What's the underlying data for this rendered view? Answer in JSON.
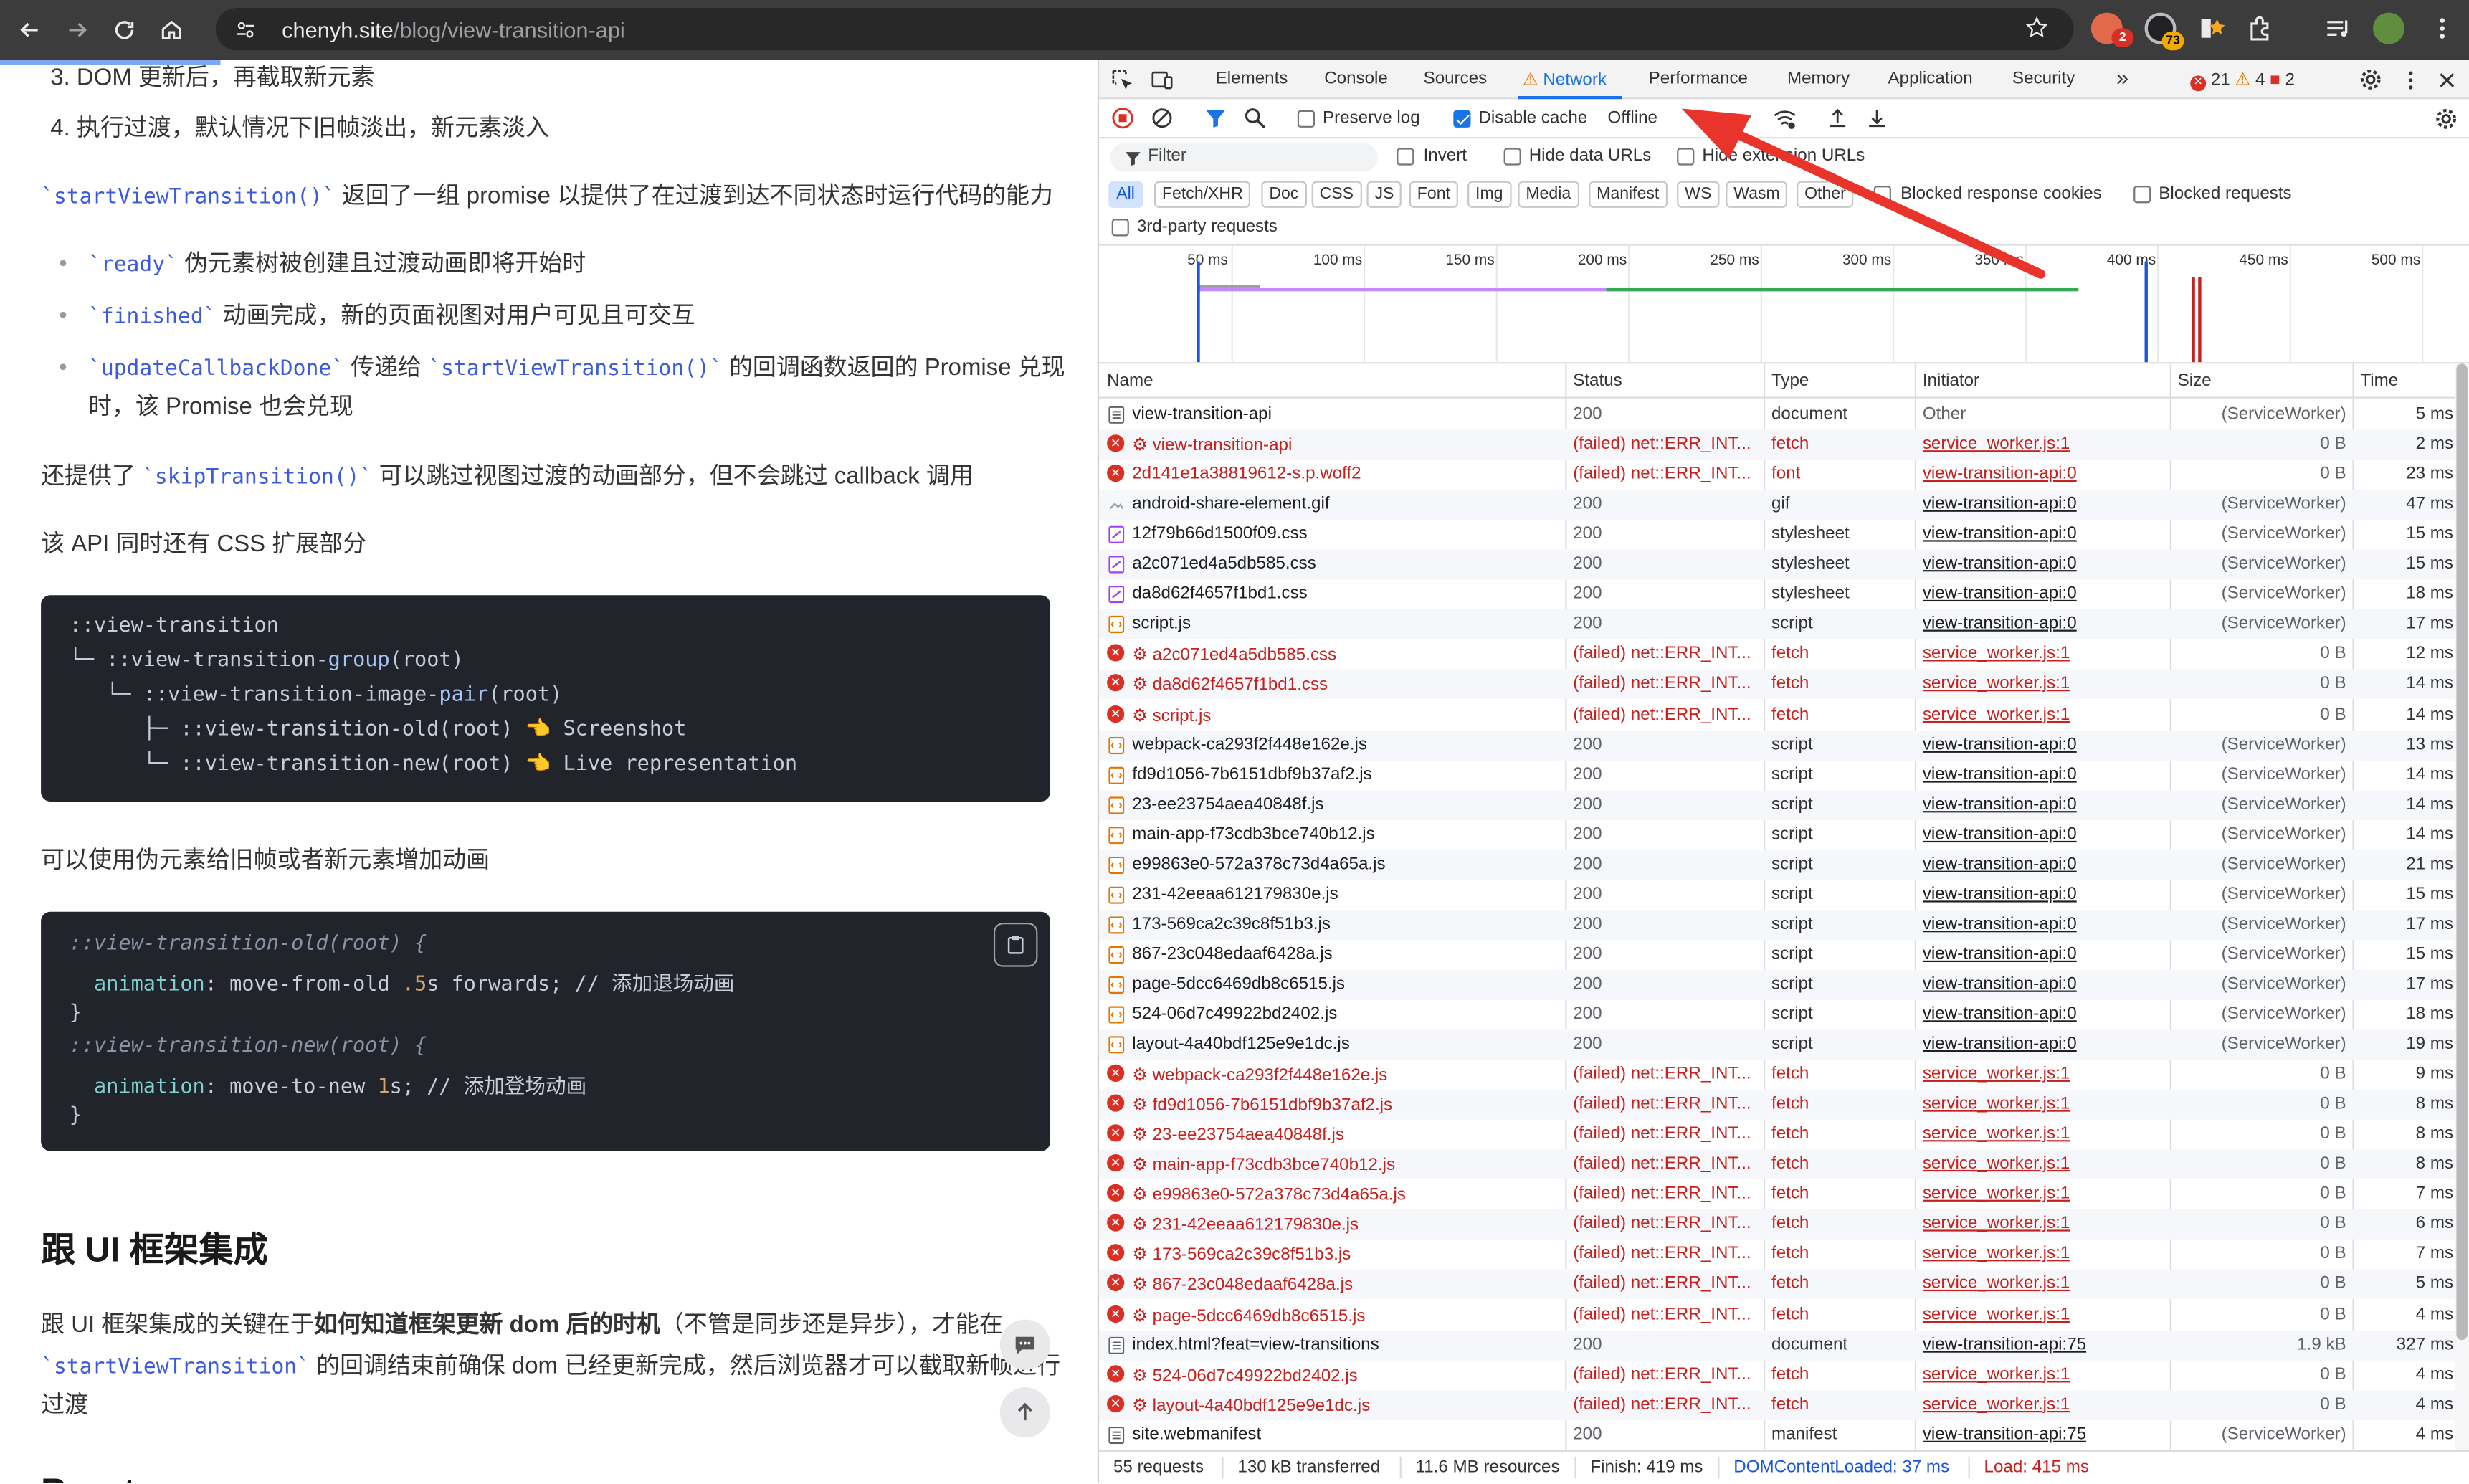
{
  "browser": {
    "url_host": "chenyh.site",
    "url_path": "/blog/view-transition-api",
    "ext_badges": [
      "2",
      "73"
    ]
  },
  "article": {
    "ol": [
      "3.  DOM 更新后，再截取新元素",
      "4.  执行过渡，默认情况下旧帧淡出，新元素淡入"
    ],
    "p1_code": "`startViewTransition()`",
    "p1_text": " 返回了一组 promise 以提供了在过渡到达不同状态时运行代码的能力",
    "li1_code": "`ready`",
    "li1_text": " 伪元素树被创建且过渡动画即将开始时",
    "li2_code": "`finished`",
    "li2_text": " 动画完成，新的页面视图对用户可见且可交互",
    "li3_code": "`updateCallbackDone`",
    "li3_mid": " 传递给 ",
    "li3_code2": "`startViewTransition()`",
    "li3_text": " 的回调函数返回的 Promise 兑现",
    "li3_text2": "时，该 Promise 也会兑现",
    "p2_text": "还提供了 ",
    "p2_code": "`skipTransition()`",
    "p2_text2": " 可以跳过视图过渡的动画部分，但不会跳过 callback 调用",
    "p3": "该 API 同时还有 CSS 扩展部分",
    "tree": {
      "l1_pre": "::view-transition",
      "l2_pre": "└─ ::view-transition-",
      "l2_fn": "group",
      "l2_arg": "(root)",
      "l3_pre": "   └─ ::view-transition-image-",
      "l3_fn": "pair",
      "l3_arg": "(root)",
      "l4_pre": "      ├─ ::view-transition-old",
      "l4_arg": "(root) ",
      "l4_emoji": "👈",
      "l4_text": " Screenshot",
      "l5_pre": "      └─ ::view-transition-new",
      "l5_arg": "(root) ",
      "l5_emoji": "👈",
      "l5_text": " Live representation"
    },
    "p4": "可以使用伪元素给旧帧或者新元素增加动画",
    "css": {
      "l1": "::view-transition-old(root) {",
      "l2_prop": "animation",
      "l2_val1": ": move-from-old ",
      "l2_num": ".5",
      "l2_val2": "s forwards; // 添加退场动画",
      "l3": "}",
      "l4": "::view-transition-new(root) {",
      "l5_prop": "animation",
      "l5_val1": ": move-to-new ",
      "l5_num": "1",
      "l5_val2": "s; // 添加登场动画",
      "l6": "}"
    },
    "h2": "跟 UI 框架集成",
    "p5_a": "跟 UI 框架集成的关键在于",
    "p5_b": "如何知道框架更新 dom 后的时机",
    "p5_c": "（不管是同步还是异步），才能在",
    "p6_code": "`startViewTransition`",
    "p6_text": " 的回调结束前确保 dom 已经更新完成，然后浏览器才可以截取新帧进行",
    "p7": "过渡",
    "h2b": "React"
  },
  "devtools": {
    "tabs": [
      "Elements",
      "Console",
      "Sources",
      "Network",
      "Performance",
      "Memory",
      "Application",
      "Security"
    ],
    "active_tab": "Network",
    "more_tabs": "»",
    "counts": {
      "errors": "21",
      "warnings": "4",
      "issues": "2"
    },
    "preserve_log": "Preserve log",
    "disable_cache": "Disable cache",
    "throttle": "Offline",
    "filter_placeholder": "Filter",
    "invert": "Invert",
    "hide_data_urls": "Hide data URLs",
    "hide_ext_urls": "Hide extension URLs",
    "type_filters": [
      "All",
      "Fetch/XHR",
      "Doc",
      "CSS",
      "JS",
      "Font",
      "Img",
      "Media",
      "Manifest",
      "WS",
      "Wasm",
      "Other"
    ],
    "blocked_cookies": "Blocked response cookies",
    "blocked_requests": "Blocked requests",
    "third_party": "3rd-party requests",
    "ticks": [
      "50 ms",
      "100 ms",
      "150 ms",
      "200 ms",
      "250 ms",
      "300 ms",
      "350 ms",
      "400 ms",
      "450 ms",
      "500 ms"
    ],
    "columns": [
      "Name",
      "Status",
      "Type",
      "Initiator",
      "Size",
      "Time"
    ],
    "rows": [
      {
        "name": "view-transition-api",
        "status": "200",
        "type": "document",
        "init": "Other",
        "size": "(ServiceWorker)",
        "time": "5 ms",
        "failed": false,
        "kind": "doc"
      },
      {
        "name": "⚙ view-transition-api",
        "status": "(failed) net::ERR_INT...",
        "type": "fetch",
        "init": "service_worker.js:1",
        "size": "0 B",
        "time": "2 ms",
        "failed": true,
        "kind": "err"
      },
      {
        "name": "2d141e1a38819612-s.p.woff2",
        "status": "(failed) net::ERR_INT...",
        "type": "font",
        "init": "view-transition-api:0",
        "size": "0 B",
        "time": "23 ms",
        "failed": true,
        "kind": "err"
      },
      {
        "name": "android-share-element.gif",
        "status": "200",
        "type": "gif",
        "init": "view-transition-api:0",
        "size": "(ServiceWorker)",
        "time": "47 ms",
        "failed": false,
        "kind": "img"
      },
      {
        "name": "12f79b66d1500f09.css",
        "status": "200",
        "type": "stylesheet",
        "init": "view-transition-api:0",
        "size": "(ServiceWorker)",
        "time": "15 ms",
        "failed": false,
        "kind": "css"
      },
      {
        "name": "a2c071ed4a5db585.css",
        "status": "200",
        "type": "stylesheet",
        "init": "view-transition-api:0",
        "size": "(ServiceWorker)",
        "time": "15 ms",
        "failed": false,
        "kind": "css"
      },
      {
        "name": "da8d62f4657f1bd1.css",
        "status": "200",
        "type": "stylesheet",
        "init": "view-transition-api:0",
        "size": "(ServiceWorker)",
        "time": "18 ms",
        "failed": false,
        "kind": "css"
      },
      {
        "name": "script.js",
        "status": "200",
        "type": "script",
        "init": "view-transition-api:0",
        "size": "(ServiceWorker)",
        "time": "17 ms",
        "failed": false,
        "kind": "js"
      },
      {
        "name": "⚙ a2c071ed4a5db585.css",
        "status": "(failed) net::ERR_INT...",
        "type": "fetch",
        "init": "service_worker.js:1",
        "size": "0 B",
        "time": "12 ms",
        "failed": true,
        "kind": "err"
      },
      {
        "name": "⚙ da8d62f4657f1bd1.css",
        "status": "(failed) net::ERR_INT...",
        "type": "fetch",
        "init": "service_worker.js:1",
        "size": "0 B",
        "time": "14 ms",
        "failed": true,
        "kind": "err"
      },
      {
        "name": "⚙ script.js",
        "status": "(failed) net::ERR_INT...",
        "type": "fetch",
        "init": "service_worker.js:1",
        "size": "0 B",
        "time": "14 ms",
        "failed": true,
        "kind": "err"
      },
      {
        "name": "webpack-ca293f2f448e162e.js",
        "status": "200",
        "type": "script",
        "init": "view-transition-api:0",
        "size": "(ServiceWorker)",
        "time": "13 ms",
        "failed": false,
        "kind": "js"
      },
      {
        "name": "fd9d1056-7b6151dbf9b37af2.js",
        "status": "200",
        "type": "script",
        "init": "view-transition-api:0",
        "size": "(ServiceWorker)",
        "time": "14 ms",
        "failed": false,
        "kind": "js"
      },
      {
        "name": "23-ee23754aea40848f.js",
        "status": "200",
        "type": "script",
        "init": "view-transition-api:0",
        "size": "(ServiceWorker)",
        "time": "14 ms",
        "failed": false,
        "kind": "js"
      },
      {
        "name": "main-app-f73cdb3bce740b12.js",
        "status": "200",
        "type": "script",
        "init": "view-transition-api:0",
        "size": "(ServiceWorker)",
        "time": "14 ms",
        "failed": false,
        "kind": "js"
      },
      {
        "name": "e99863e0-572a378c73d4a65a.js",
        "status": "200",
        "type": "script",
        "init": "view-transition-api:0",
        "size": "(ServiceWorker)",
        "time": "21 ms",
        "failed": false,
        "kind": "js"
      },
      {
        "name": "231-42eeaa612179830e.js",
        "status": "200",
        "type": "script",
        "init": "view-transition-api:0",
        "size": "(ServiceWorker)",
        "time": "15 ms",
        "failed": false,
        "kind": "js"
      },
      {
        "name": "173-569ca2c39c8f51b3.js",
        "status": "200",
        "type": "script",
        "init": "view-transition-api:0",
        "size": "(ServiceWorker)",
        "time": "17 ms",
        "failed": false,
        "kind": "js"
      },
      {
        "name": "867-23c048edaaf6428a.js",
        "status": "200",
        "type": "script",
        "init": "view-transition-api:0",
        "size": "(ServiceWorker)",
        "time": "15 ms",
        "failed": false,
        "kind": "js"
      },
      {
        "name": "page-5dcc6469db8c6515.js",
        "status": "200",
        "type": "script",
        "init": "view-transition-api:0",
        "size": "(ServiceWorker)",
        "time": "17 ms",
        "failed": false,
        "kind": "js"
      },
      {
        "name": "524-06d7c49922bd2402.js",
        "status": "200",
        "type": "script",
        "init": "view-transition-api:0",
        "size": "(ServiceWorker)",
        "time": "18 ms",
        "failed": false,
        "kind": "js"
      },
      {
        "name": "layout-4a40bdf125e9e1dc.js",
        "status": "200",
        "type": "script",
        "init": "view-transition-api:0",
        "size": "(ServiceWorker)",
        "time": "19 ms",
        "failed": false,
        "kind": "js"
      },
      {
        "name": "⚙ webpack-ca293f2f448e162e.js",
        "status": "(failed) net::ERR_INT...",
        "type": "fetch",
        "init": "service_worker.js:1",
        "size": "0 B",
        "time": "9 ms",
        "failed": true,
        "kind": "err"
      },
      {
        "name": "⚙ fd9d1056-7b6151dbf9b37af2.js",
        "status": "(failed) net::ERR_INT...",
        "type": "fetch",
        "init": "service_worker.js:1",
        "size": "0 B",
        "time": "8 ms",
        "failed": true,
        "kind": "err"
      },
      {
        "name": "⚙ 23-ee23754aea40848f.js",
        "status": "(failed) net::ERR_INT...",
        "type": "fetch",
        "init": "service_worker.js:1",
        "size": "0 B",
        "time": "8 ms",
        "failed": true,
        "kind": "err"
      },
      {
        "name": "⚙ main-app-f73cdb3bce740b12.js",
        "status": "(failed) net::ERR_INT...",
        "type": "fetch",
        "init": "service_worker.js:1",
        "size": "0 B",
        "time": "8 ms",
        "failed": true,
        "kind": "err"
      },
      {
        "name": "⚙ e99863e0-572a378c73d4a65a.js",
        "status": "(failed) net::ERR_INT...",
        "type": "fetch",
        "init": "service_worker.js:1",
        "size": "0 B",
        "time": "7 ms",
        "failed": true,
        "kind": "err"
      },
      {
        "name": "⚙ 231-42eeaa612179830e.js",
        "status": "(failed) net::ERR_INT...",
        "type": "fetch",
        "init": "service_worker.js:1",
        "size": "0 B",
        "time": "6 ms",
        "failed": true,
        "kind": "err"
      },
      {
        "name": "⚙ 173-569ca2c39c8f51b3.js",
        "status": "(failed) net::ERR_INT...",
        "type": "fetch",
        "init": "service_worker.js:1",
        "size": "0 B",
        "time": "7 ms",
        "failed": true,
        "kind": "err"
      },
      {
        "name": "⚙ 867-23c048edaaf6428a.js",
        "status": "(failed) net::ERR_INT...",
        "type": "fetch",
        "init": "service_worker.js:1",
        "size": "0 B",
        "time": "5 ms",
        "failed": true,
        "kind": "err"
      },
      {
        "name": "⚙ page-5dcc6469db8c6515.js",
        "status": "(failed) net::ERR_INT...",
        "type": "fetch",
        "init": "service_worker.js:1",
        "size": "0 B",
        "time": "4 ms",
        "failed": true,
        "kind": "err"
      },
      {
        "name": "index.html?feat=view-transitions",
        "status": "200",
        "type": "document",
        "init": "view-transition-api:75",
        "size": "1.9 kB",
        "time": "327 ms",
        "failed": false,
        "kind": "doc"
      },
      {
        "name": "⚙ 524-06d7c49922bd2402.js",
        "status": "(failed) net::ERR_INT...",
        "type": "fetch",
        "init": "service_worker.js:1",
        "size": "0 B",
        "time": "4 ms",
        "failed": true,
        "kind": "err"
      },
      {
        "name": "⚙ layout-4a40bdf125e9e1dc.js",
        "status": "(failed) net::ERR_INT...",
        "type": "fetch",
        "init": "service_worker.js:1",
        "size": "0 B",
        "time": "4 ms",
        "failed": true,
        "kind": "err"
      },
      {
        "name": "site.webmanifest",
        "status": "200",
        "type": "manifest",
        "init": "view-transition-api:75",
        "size": "(ServiceWorker)",
        "time": "4 ms",
        "failed": false,
        "kind": "doc"
      }
    ],
    "status_bar": [
      "55 requests",
      "130 kB transferred",
      "11.6 MB resources",
      "Finish: 419 ms",
      "DOMContentLoaded: 37 ms",
      "Load: 415 ms"
    ],
    "colors": {
      "accent": "#1a73e8",
      "error": "#c5221f",
      "dcl": "#1a56db",
      "load": "#c5221f"
    }
  }
}
